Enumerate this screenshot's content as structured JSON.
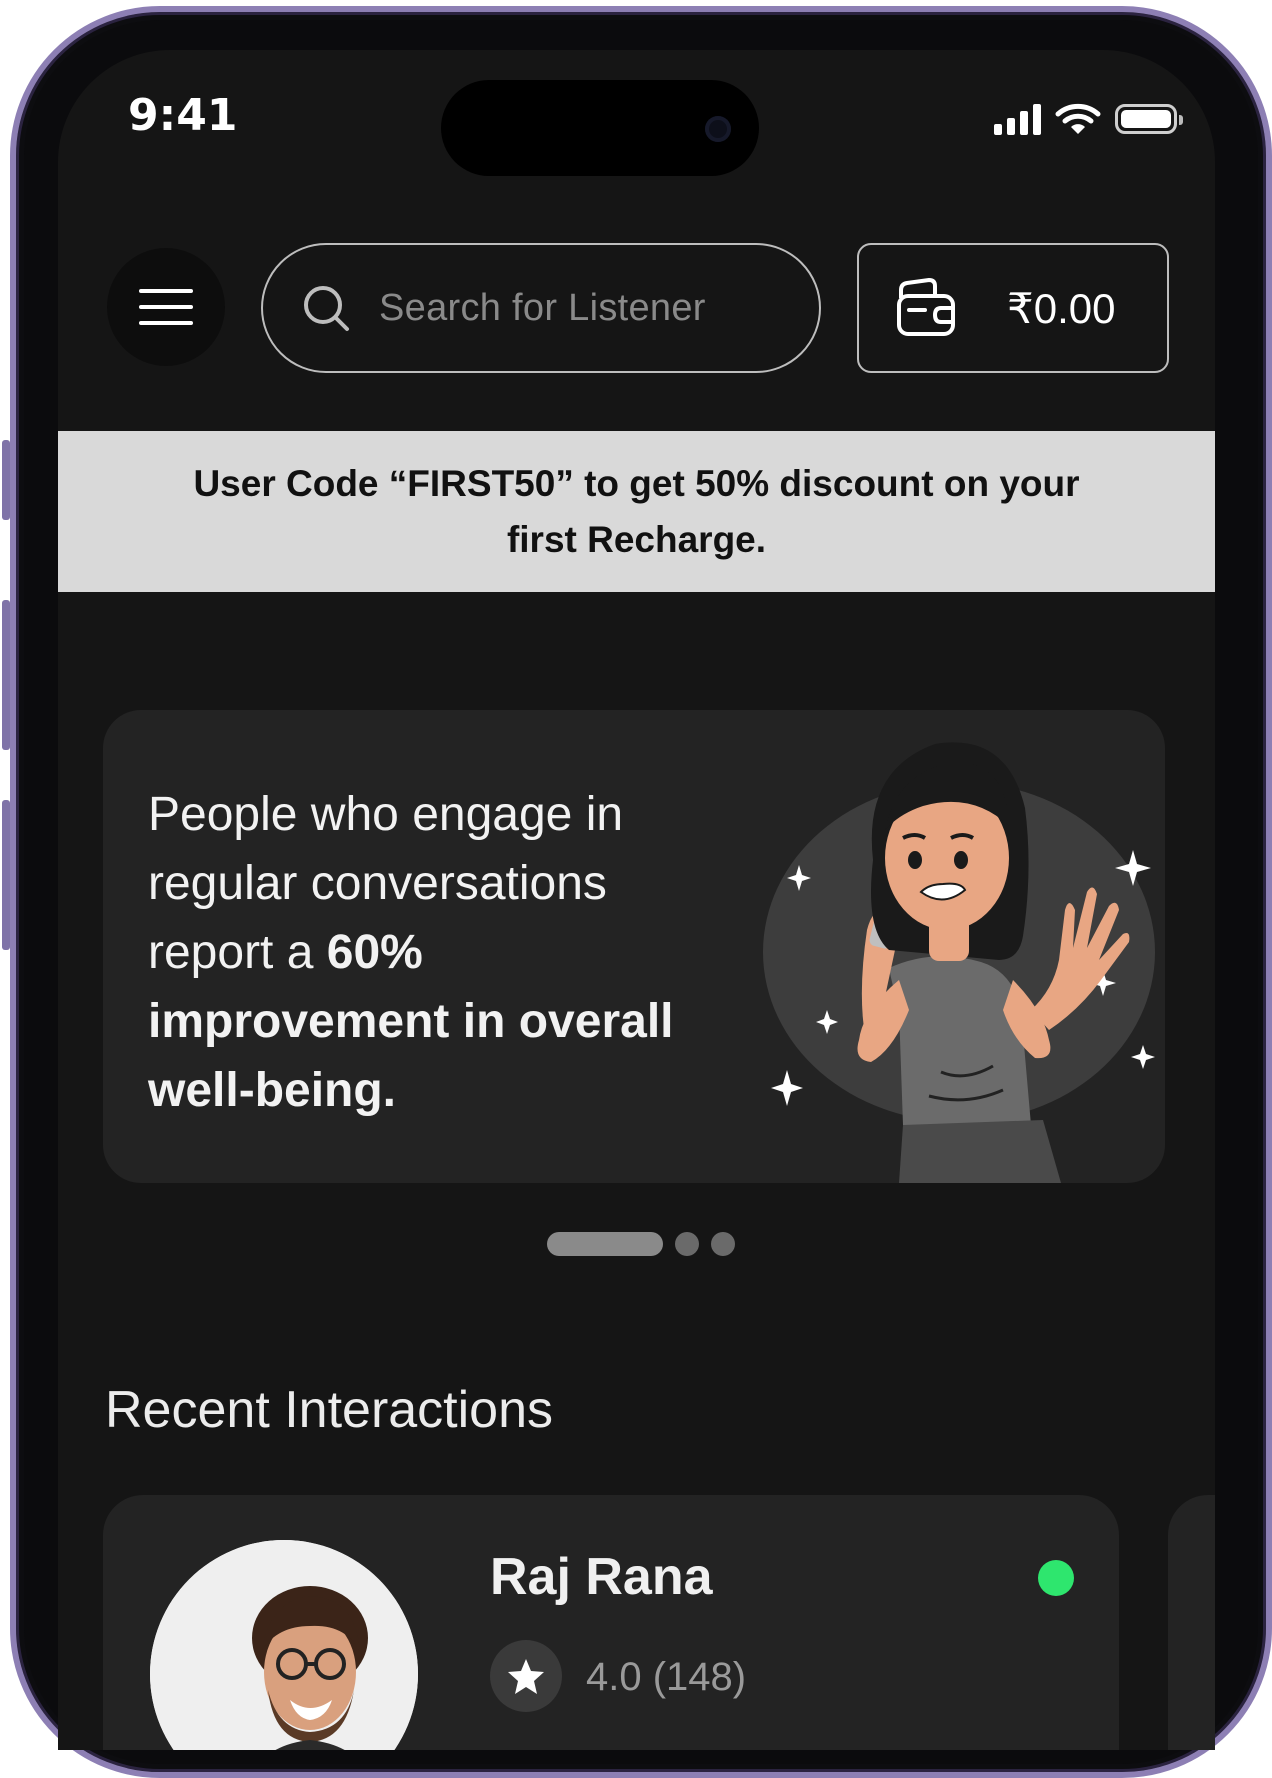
{
  "status_bar": {
    "time": "9:41"
  },
  "header": {
    "search_placeholder": "Search for Listener",
    "wallet_balance": "₹0.00"
  },
  "promo": {
    "text": "User Code “FIRST50” to get 50% discount on your first Recharge."
  },
  "banner": {
    "text_regular": "People who engage in regular conversations report a ",
    "text_bold": "60% improvement in overall well-being.",
    "pagination": {
      "active_index": 0,
      "count": 3
    }
  },
  "recent": {
    "title": "Recent Interactions",
    "items": [
      {
        "name": "Raj Rana",
        "rating": "4.0 (148)",
        "online": true,
        "status_color": "#2ee66e"
      }
    ]
  },
  "colors": {
    "background": "#151515",
    "card": "#232323",
    "promo_bg": "#d9d9d9",
    "frame": "#8d7fb4"
  }
}
